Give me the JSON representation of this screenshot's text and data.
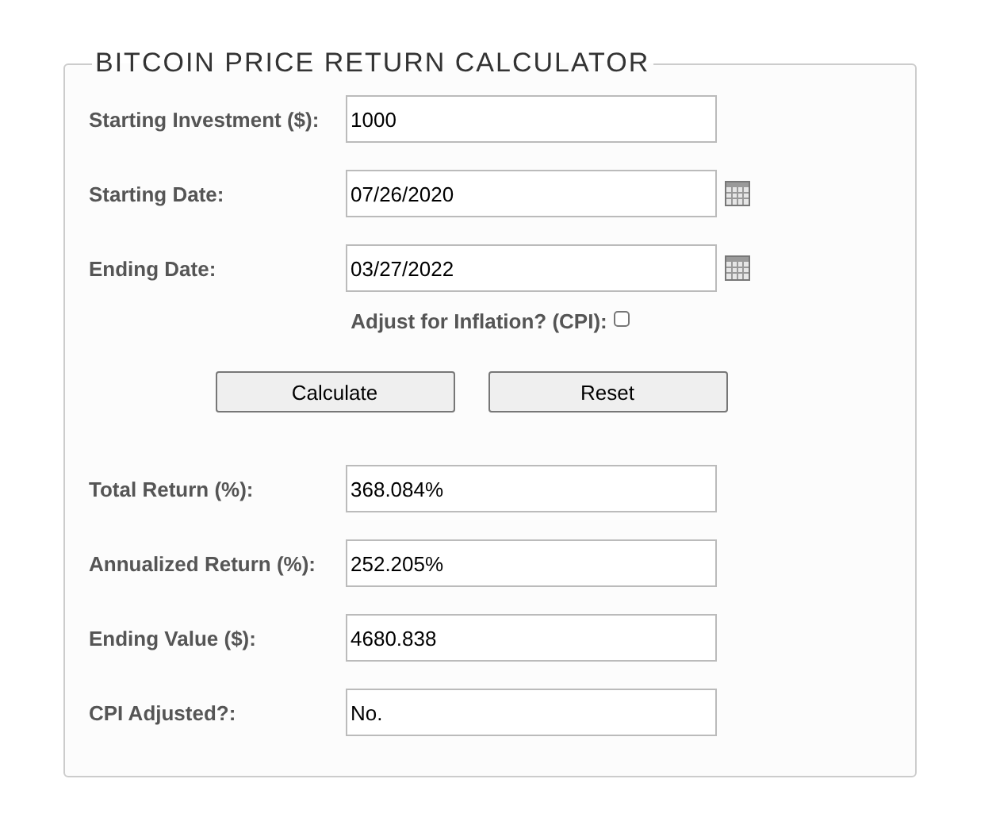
{
  "title": "BITCOIN PRICE RETURN CALCULATOR",
  "inputs": [
    {
      "label": "Starting Investment ($):",
      "value": "1000",
      "kind": "text"
    },
    {
      "label": "Starting Date:",
      "value": "07/26/2020",
      "kind": "date"
    },
    {
      "label": "Ending Date:",
      "value": "03/27/2022",
      "kind": "date"
    }
  ],
  "inflation": {
    "label": "Adjust for Inflation? (CPI):",
    "checked": false
  },
  "buttons": [
    "Calculate",
    "Reset"
  ],
  "results": [
    {
      "label": "Total Return (%):",
      "value": "368.084%"
    },
    {
      "label": "Annualized Return (%):",
      "value": "252.205%"
    },
    {
      "label": "Ending Value ($):",
      "value": "4680.838"
    },
    {
      "label": "CPI Adjusted?:",
      "value": "No."
    }
  ]
}
